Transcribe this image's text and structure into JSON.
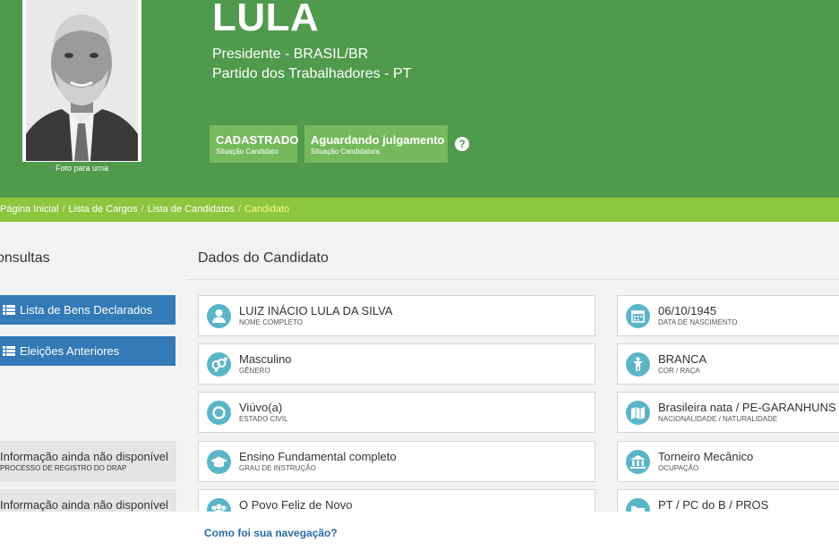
{
  "header": {
    "name": "LULA",
    "office": "Presidente - BRASIL/BR",
    "party": "Partido dos Trabalhadores - PT",
    "photo_caption": "Foto para urna",
    "badges": [
      {
        "main": "CADASTRADO",
        "sub": "Situação Candidato"
      },
      {
        "main": "Aguardando julgamento",
        "sub": "Situação Candidatura"
      }
    ],
    "help_glyph": "?"
  },
  "breadcrumb": {
    "items": [
      "Página Inicial",
      "Lista de Cargos",
      "Lista de Candidatos"
    ],
    "current": "Candidato",
    "separator": "/"
  },
  "sidebar": {
    "title": "onsultas",
    "buttons": [
      "Lista de Bens Declarados",
      "Eleições Anteriores"
    ],
    "info": [
      {
        "main": "Informação ainda não disponível",
        "sub": "PROCESSO DE REGISTRO DO DRAP"
      },
      {
        "main": "Informação ainda não disponível",
        "sub": ""
      }
    ]
  },
  "main": {
    "title": "Dados do Candidato",
    "left": [
      {
        "value": "LUIZ INÁCIO LULA DA SILVA",
        "label": "NOME COMPLETO",
        "icon": "person-icon"
      },
      {
        "value": "Masculino",
        "label": "GÊNERO",
        "icon": "gender-icon"
      },
      {
        "value": "Viúvo(a)",
        "label": "ESTADO CIVIL",
        "icon": "ring-icon"
      },
      {
        "value": "Ensino Fundamental completo",
        "label": "GRAU DE INSTRUÇÃO",
        "icon": "graduation-cap-icon"
      },
      {
        "value": "O Povo Feliz de Novo",
        "label": "",
        "icon": "group-icon"
      }
    ],
    "right": [
      {
        "value": "06/10/1945",
        "label": "DATA DE NASCIMENTO",
        "icon": "calendar-icon"
      },
      {
        "value": "BRANCA",
        "label": "COR / RAÇA",
        "icon": "figure-icon"
      },
      {
        "value": "Brasileira nata / PE-GARANHUNS",
        "label": "NACIONALIDADE / NATURALIDADE",
        "icon": "map-icon"
      },
      {
        "value": "Torneiro Mecânico",
        "label": "OCUPAÇÃO",
        "icon": "bank-icon"
      },
      {
        "value": "PT / PC do B / PROS",
        "label": "",
        "icon": "folder-icon"
      }
    ]
  },
  "feedback": {
    "link": "Como foi sua navegação?"
  },
  "colors": {
    "header_green": "#4f9a4c",
    "breadcrumb_green": "#8cc63e",
    "badge_green": "#76b95c",
    "button_blue": "#337ab7",
    "icon_teal": "#5bb5c8"
  }
}
